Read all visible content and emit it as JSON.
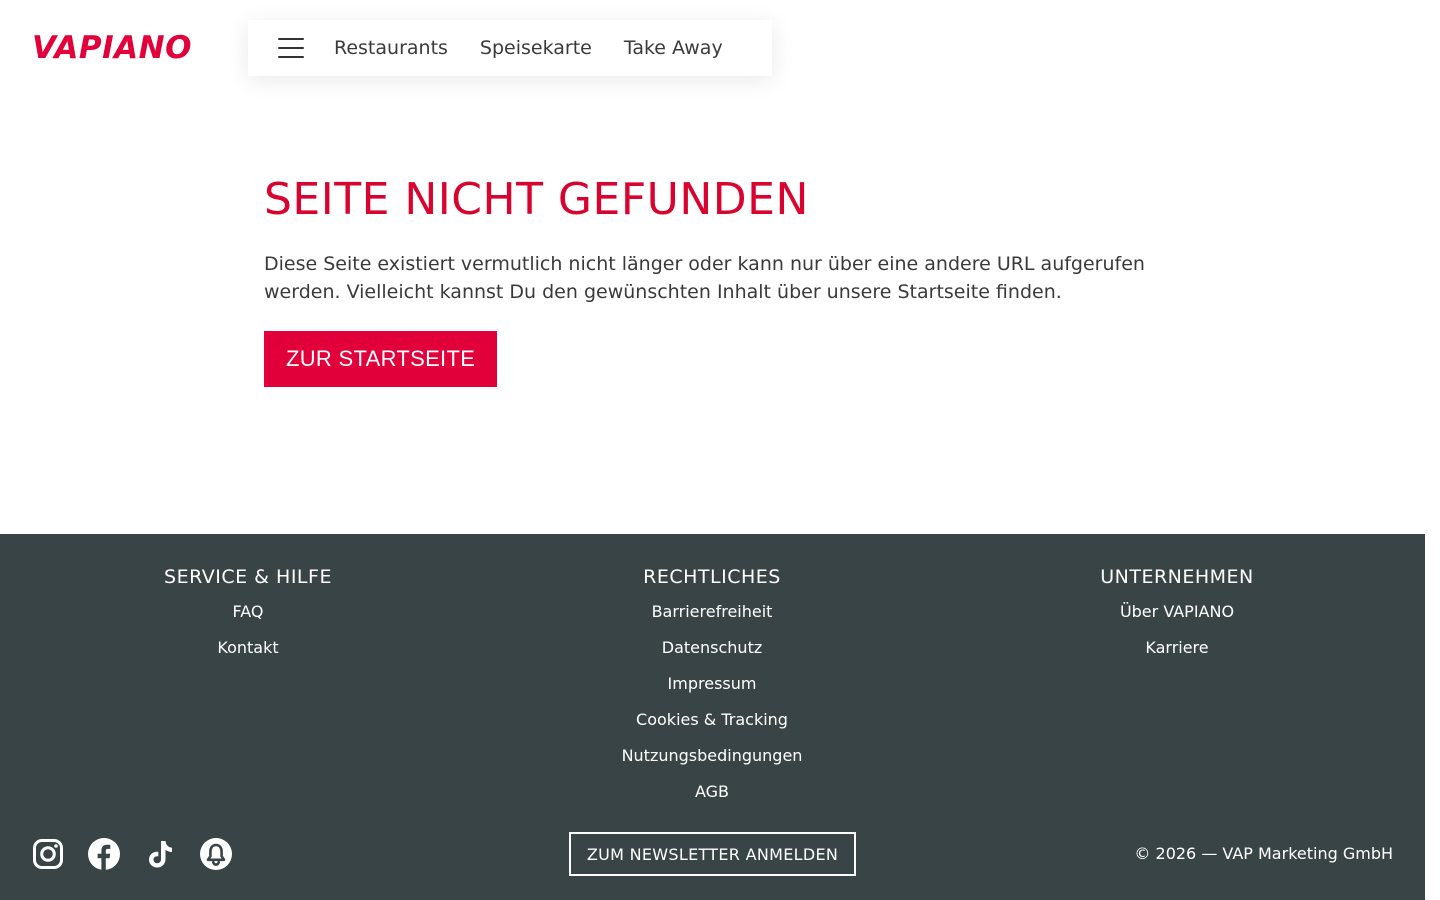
{
  "header": {
    "logo_text": "VAPIANO",
    "nav": {
      "menu_icon": "hamburger-menu-icon",
      "links": [
        "Restaurants",
        "Speisekarte",
        "Take Away"
      ]
    }
  },
  "main": {
    "title": "SEITE NICHT GEFUNDEN",
    "text": "Diese Seite existiert vermutlich nicht länger oder kann nur über eine andere URL aufgerufen werden. Vielleicht kannst Du den gewünschten Inhalt über unsere Startseite finden.",
    "button_label": "ZUR STARTSEITE"
  },
  "footer": {
    "columns": [
      {
        "heading": "SERVICE & HILFE",
        "links": [
          "FAQ",
          "Kontakt"
        ]
      },
      {
        "heading": "RECHTLICHES",
        "links": [
          "Barrierefreiheit",
          "Datenschutz",
          "Impressum",
          "Cookies & Tracking",
          "Nutzungsbedingungen",
          "AGB"
        ]
      },
      {
        "heading": "UNTERNEHMEN",
        "links": [
          "Über VAPIANO",
          "Karriere"
        ]
      }
    ],
    "social_icons": [
      "instagram-icon",
      "facebook-icon",
      "tiktok-icon",
      "app-bell-icon"
    ],
    "newsletter_label": "ZUM NEWSLETTER ANMELDEN",
    "copyright": "© 2026 — VAP Marketing GmbH"
  },
  "colors": {
    "brand_red": "#e2003a",
    "title_red": "#d9032f",
    "footer_bg": "#394446",
    "text": "#3a3a3a"
  }
}
